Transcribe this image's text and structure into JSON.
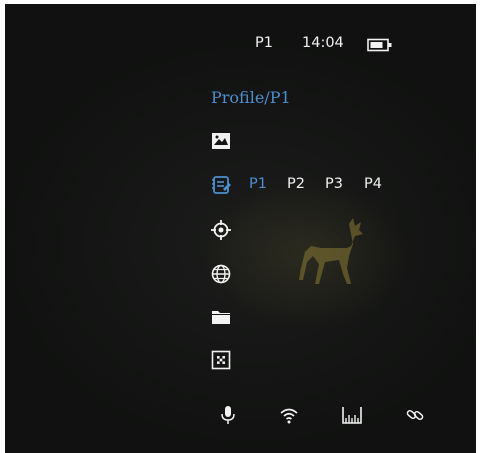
{
  "status_bar": {
    "profile": "P1",
    "time": "14:04",
    "battery_icon": "battery-icon"
  },
  "menu": {
    "title": "Profile/P1",
    "items": [
      {
        "icon": "image-icon"
      },
      {
        "icon": "profile-icon"
      },
      {
        "icon": "crosshair-icon"
      },
      {
        "icon": "globe-icon"
      },
      {
        "icon": "folder-icon"
      },
      {
        "icon": "pattern-icon"
      }
    ],
    "profile_options": [
      {
        "label": "P1",
        "selected": true
      },
      {
        "label": "P2",
        "selected": false
      },
      {
        "label": "P3",
        "selected": false
      },
      {
        "label": "P4",
        "selected": false
      }
    ]
  },
  "bottom_bar": {
    "icons": [
      "microphone-icon",
      "wifi-icon",
      "ruler-icon",
      "link-icon"
    ]
  },
  "colors": {
    "accent": "#4c8fcf",
    "text": "#f0f0f0",
    "background": "#131413"
  }
}
